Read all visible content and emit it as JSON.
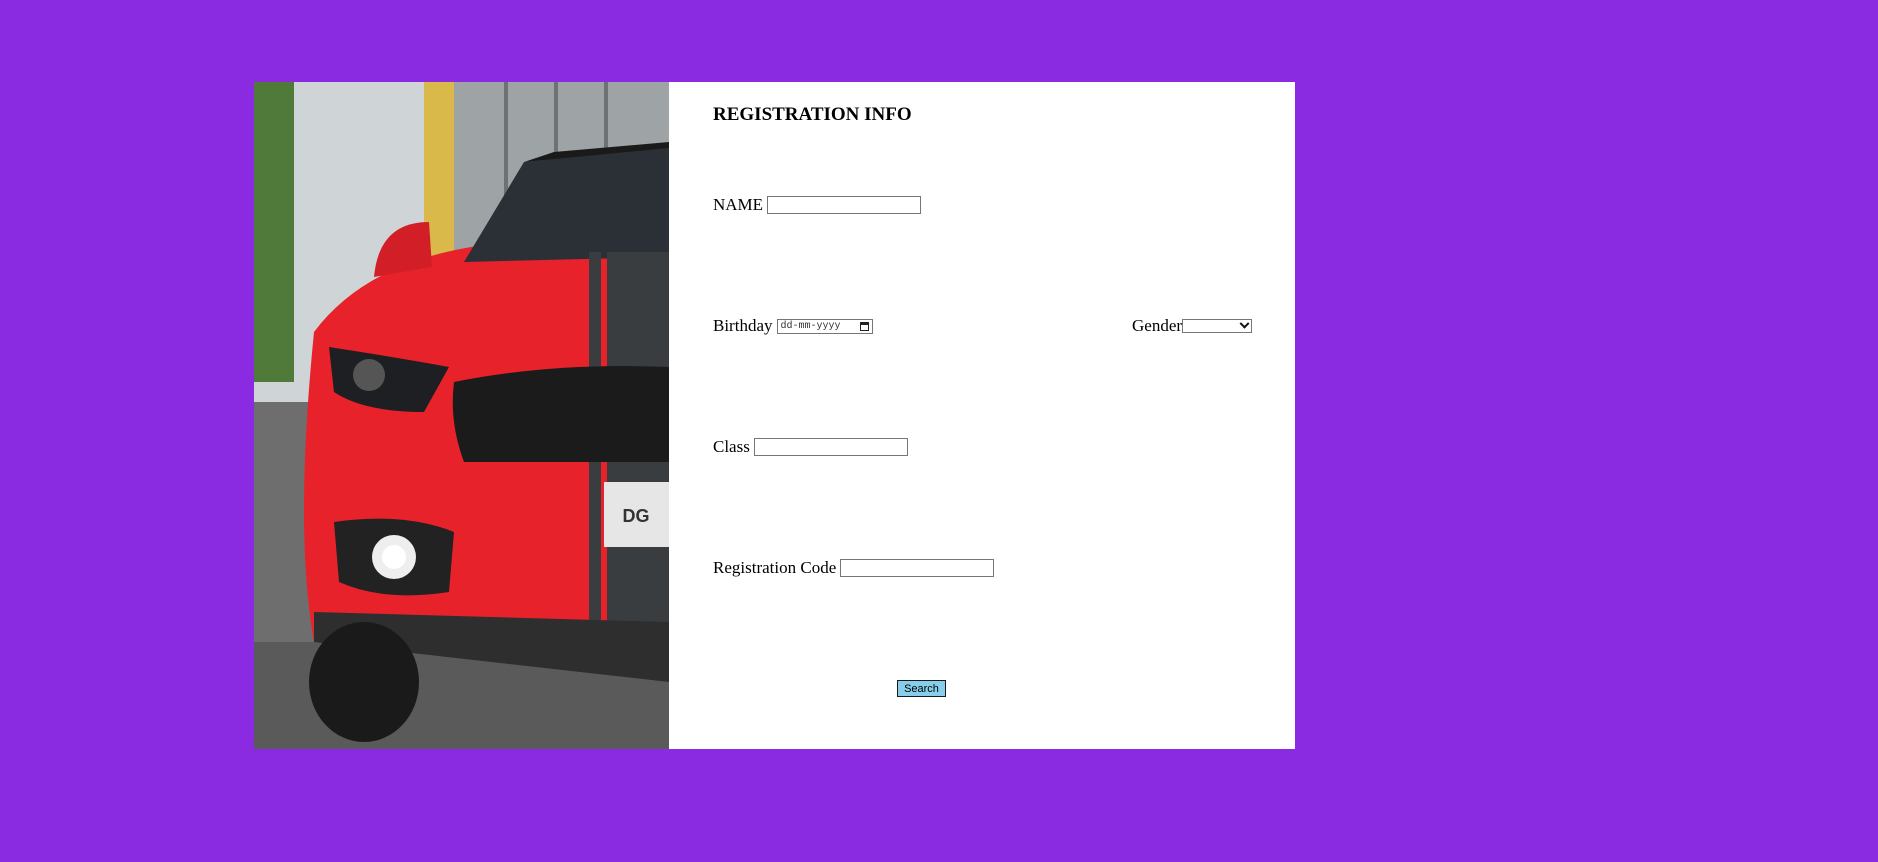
{
  "photo": {
    "alt": "red sports car front",
    "plate_text": "DG"
  },
  "form": {
    "title": "REGISTRATION INFO",
    "name_label": "NAME",
    "name_value": "",
    "birthday_label": "Birthday",
    "birthday_placeholder": "dd-mm-yyyy",
    "gender_label": "Gender",
    "gender_value": "",
    "class_label": "Class",
    "class_value": "",
    "code_label": "Registration Code",
    "code_value": "",
    "search_label": "Search"
  },
  "colors": {
    "background": "#8a2be2",
    "card": "#ffffff",
    "button": "#87ceeb"
  }
}
